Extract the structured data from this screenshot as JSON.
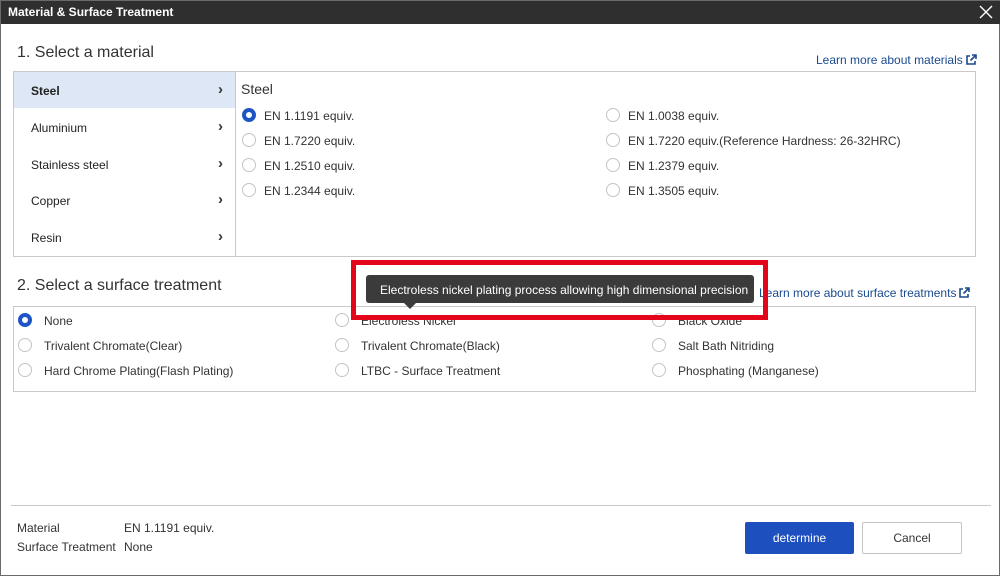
{
  "dialog": {
    "title": "Material & Surface Treatment"
  },
  "material_section": {
    "heading": "1. Select a material",
    "learn_more": "Learn more about materials",
    "categories": [
      {
        "label": "Steel",
        "active": true
      },
      {
        "label": "Aluminium",
        "active": false
      },
      {
        "label": "Stainless steel",
        "active": false
      },
      {
        "label": "Copper",
        "active": false
      },
      {
        "label": "Resin",
        "active": false
      }
    ],
    "grade_title": "Steel",
    "grades": [
      {
        "label": "EN 1.1191 equiv.",
        "selected": true
      },
      {
        "label": "EN 1.0038 equiv.",
        "selected": false
      },
      {
        "label": "EN 1.7220 equiv.",
        "selected": false
      },
      {
        "label": "EN 1.7220 equiv.(Reference Hardness: 26-32HRC)",
        "selected": false
      },
      {
        "label": "EN 1.2510 equiv.",
        "selected": false
      },
      {
        "label": "EN 1.2379 equiv.",
        "selected": false
      },
      {
        "label": "EN 1.2344 equiv.",
        "selected": false
      },
      {
        "label": "EN 1.3505 equiv.",
        "selected": false
      }
    ]
  },
  "surface_section": {
    "heading": "2. Select a surface treatment",
    "learn_more": "Learn more about surface treatments",
    "treatments": [
      {
        "label": "None",
        "selected": true
      },
      {
        "label": "Electroless Nickel",
        "selected": false
      },
      {
        "label": "Black Oxide",
        "selected": false
      },
      {
        "label": "Trivalent Chromate(Clear)",
        "selected": false
      },
      {
        "label": "Trivalent Chromate(Black)",
        "selected": false
      },
      {
        "label": "Salt Bath Nitriding",
        "selected": false
      },
      {
        "label": "Hard Chrome Plating(Flash Plating)",
        "selected": false
      },
      {
        "label": "LTBC - Surface Treatment",
        "selected": false
      },
      {
        "label": "Phosphating (Manganese)",
        "selected": false
      }
    ]
  },
  "tooltip": {
    "text": "Electroless nickel plating process allowing high dimensional precision"
  },
  "summary": {
    "material_label": "Material",
    "material_value": "EN 1.1191 equiv.",
    "surface_label": "Surface Treatment",
    "surface_value": "None"
  },
  "buttons": {
    "determine": "determine",
    "cancel": "Cancel"
  },
  "colors": {
    "accent": "#1d4fbf",
    "highlight": "#e3051a",
    "titlebar": "#2f2f2f"
  }
}
